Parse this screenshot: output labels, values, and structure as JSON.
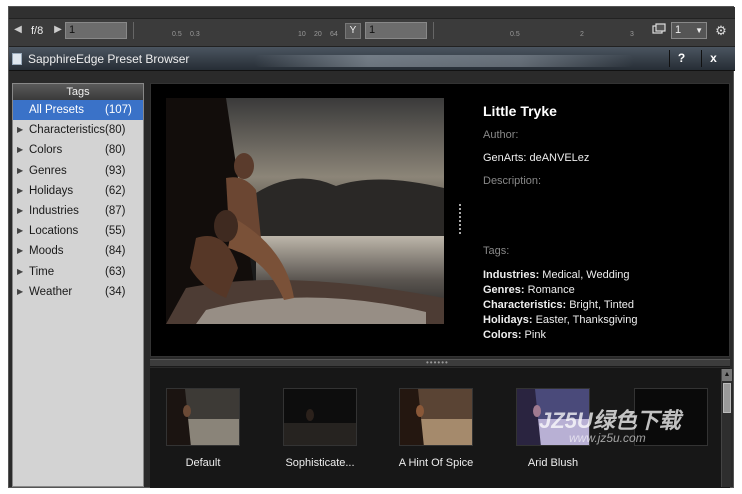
{
  "toolbar": {
    "frame_text": "f/8",
    "x_field": "1",
    "y_label": "Y",
    "y_field": "1",
    "ruler_x_ticks": [
      "0.5",
      "0.3",
      "10",
      "20",
      "64"
    ],
    "ruler_y_ticks": [
      "0.5",
      "2",
      "3"
    ],
    "page_value": "1",
    "icons": [
      "left-arrow-icon",
      "right-arrow-icon",
      "monitor-icon",
      "settings-icon"
    ]
  },
  "window": {
    "title": "SapphireEdge Preset Browser",
    "help_label": "?",
    "close_label": "x"
  },
  "sidebar": {
    "header": "Tags",
    "items": [
      {
        "label": "All Presets",
        "count": "(107)",
        "active": true,
        "expandable": false
      },
      {
        "label": "Characteristics",
        "count": "(80)",
        "active": false,
        "expandable": true
      },
      {
        "label": "Colors",
        "count": "(80)",
        "active": false,
        "expandable": true
      },
      {
        "label": "Genres",
        "count": "(93)",
        "active": false,
        "expandable": true
      },
      {
        "label": "Holidays",
        "count": "(62)",
        "active": false,
        "expandable": true
      },
      {
        "label": "Industries",
        "count": "(87)",
        "active": false,
        "expandable": true
      },
      {
        "label": "Locations",
        "count": "(55)",
        "active": false,
        "expandable": true
      },
      {
        "label": "Moods",
        "count": "(84)",
        "active": false,
        "expandable": true
      },
      {
        "label": "Time",
        "count": "(63)",
        "active": false,
        "expandable": true
      },
      {
        "label": "Weather",
        "count": "(34)",
        "active": false,
        "expandable": true
      }
    ]
  },
  "preview": {
    "title": "Little Tryke",
    "author_label": "Author:",
    "author_value": "GenArts: deANVELez",
    "description_label": "Description:",
    "tags_label": "Tags:",
    "tag_lines": [
      {
        "key": "Industries:",
        "value": " Medical, Wedding"
      },
      {
        "key": "Genres:",
        "value": " Romance"
      },
      {
        "key": "Characteristics:",
        "value": " Bright, Tinted"
      },
      {
        "key": "Holidays:",
        "value": " Easter, Thanksgiving"
      },
      {
        "key": "Colors:",
        "value": " Pink"
      }
    ]
  },
  "thumbnails": [
    {
      "label": "Default"
    },
    {
      "label": "Sophisticate..."
    },
    {
      "label": "A Hint Of Spice"
    },
    {
      "label": "Arid Blush"
    },
    {
      "label": ""
    }
  ],
  "watermark": {
    "main": "JZ5U绿色下载",
    "sub": "www.jz5u.com"
  },
  "colors": {
    "selection": "#3a72c8",
    "panel_bg": "#000000",
    "sidebar_bg": "#d3d3d3"
  }
}
